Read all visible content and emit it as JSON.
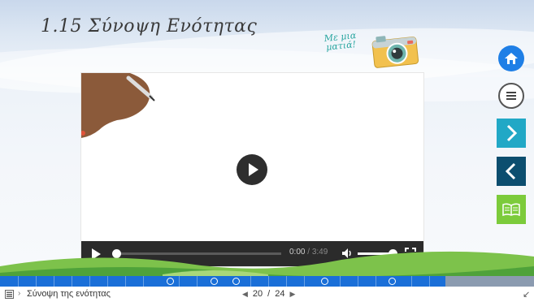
{
  "slide": {
    "title": "1.15 Σύνοψη Ενότητας",
    "badge_text": "Με μια ματιά!",
    "camera_icon": "camera-icon"
  },
  "video": {
    "current_time": "0:00",
    "separator": " / ",
    "duration": "3:49",
    "icons": [
      "play-icon",
      "volume-icon",
      "fullscreen-icon"
    ]
  },
  "side_nav": {
    "items": [
      "home-icon",
      "menu-icon",
      "next-icon",
      "previous-icon",
      "book-icon"
    ],
    "colors": {
      "home": "#1f7fe6",
      "next": "#21a8c6",
      "prev": "#0c4e6f",
      "book": "#7ccb3b"
    }
  },
  "progress": {
    "completed_fraction": 0.834,
    "accent": "#1a6fd8"
  },
  "status_bar": {
    "section_label": "Σύνοψη της ενότητας",
    "page_current": "20",
    "page_separator": "/",
    "page_total": "24"
  }
}
